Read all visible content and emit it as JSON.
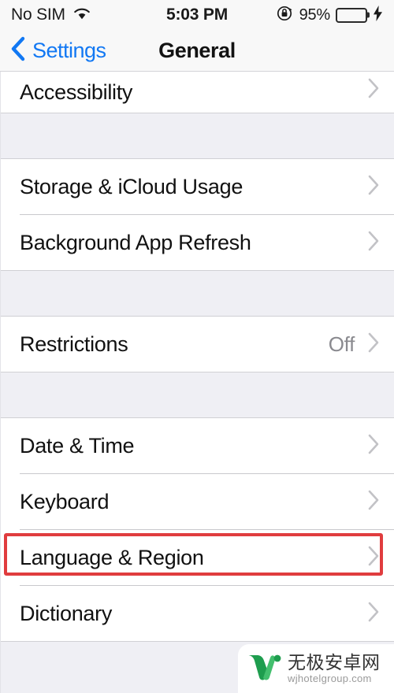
{
  "status_bar": {
    "carrier": "No SIM",
    "wifi_icon": "wifi-icon",
    "time": "5:03 PM",
    "rotation_lock_icon": "rotation-lock-icon",
    "battery_percent": "95%",
    "battery_level": 95,
    "battery_color": "#4cd549",
    "charging_icon": "lightning-bolt-icon"
  },
  "nav_bar": {
    "back_icon": "chevron-left-icon",
    "back_label": "Settings",
    "title": "General",
    "accent_color": "#1278f3"
  },
  "sections": [
    {
      "id": "accessibility-section",
      "clipped_top": true,
      "rows": [
        {
          "name": "accessibility",
          "label": "Accessibility",
          "value": "",
          "disclosure": true
        }
      ]
    },
    {
      "id": "storage-section",
      "rows": [
        {
          "name": "storage-icloud-usage",
          "label": "Storage & iCloud Usage",
          "value": "",
          "disclosure": true
        },
        {
          "name": "background-app-refresh",
          "label": "Background App Refresh",
          "value": "",
          "disclosure": true
        }
      ]
    },
    {
      "id": "restrictions-section",
      "rows": [
        {
          "name": "restrictions",
          "label": "Restrictions",
          "value": "Off",
          "disclosure": true
        }
      ]
    },
    {
      "id": "locale-section",
      "rows": [
        {
          "name": "date-time",
          "label": "Date & Time",
          "value": "",
          "disclosure": true
        },
        {
          "name": "keyboard",
          "label": "Keyboard",
          "value": "",
          "disclosure": true
        },
        {
          "name": "language-region",
          "label": "Language & Region",
          "value": "",
          "disclosure": true,
          "highlighted": true
        },
        {
          "name": "dictionary",
          "label": "Dictionary",
          "value": "",
          "disclosure": true
        }
      ]
    }
  ],
  "annotation": {
    "target": "Language & Region",
    "color": "#e03c3e"
  },
  "watermark": {
    "logo_icon": "w-logo-icon",
    "site_name": "无极安卓网",
    "site_url": "wjhotelgroup.com",
    "logo_color_dark": "#1e9d4e",
    "logo_color_light": "#43bf6e"
  }
}
